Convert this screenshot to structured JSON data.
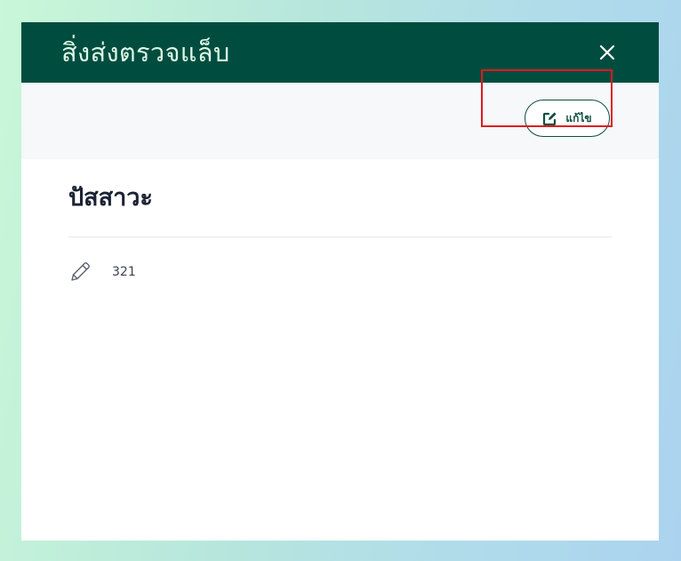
{
  "modal": {
    "title": "สิ่งส่งตรวจแล็บ",
    "close_icon": "close-icon"
  },
  "toolbar": {
    "edit_label": "แก้ไข",
    "edit_icon": "edit-square-icon"
  },
  "specimen": {
    "name": "ปัสสาวะ",
    "value_icon": "pencil-icon",
    "value": "321"
  },
  "colors": {
    "header_bg": "#004d3f",
    "header_text": "#ddf7e6",
    "accent": "#0b4f40",
    "highlight": "#e0191f"
  }
}
